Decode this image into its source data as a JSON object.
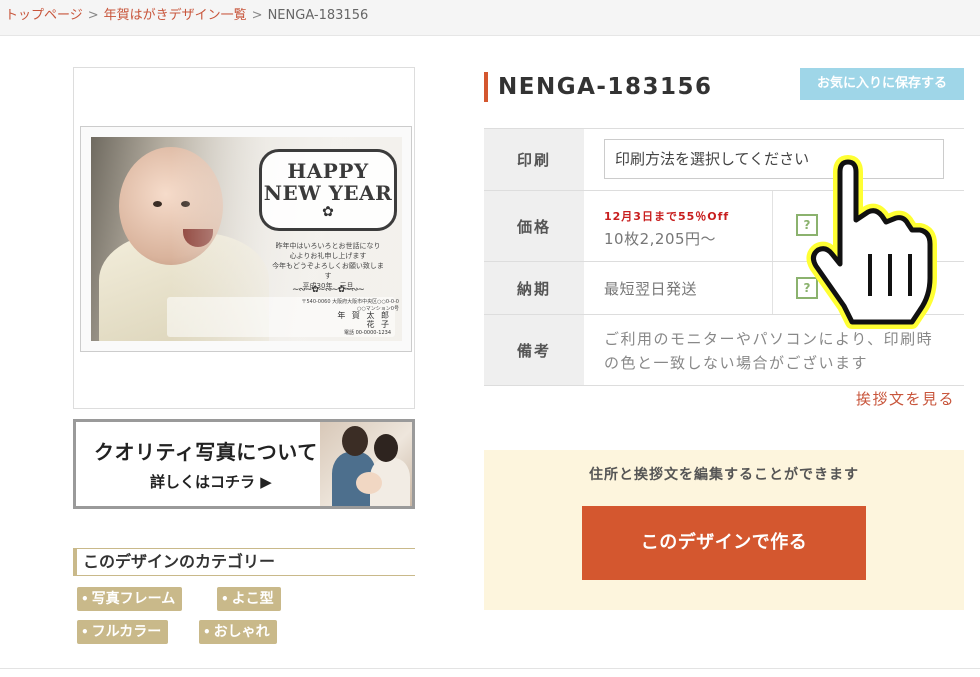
{
  "breadcrumb": {
    "items": [
      "トップページ",
      "年賀はがきデザイン一覧"
    ],
    "separator": ">",
    "current": "NENGA-183156"
  },
  "preview": {
    "card": {
      "greeting_heading_line1": "HAPPY",
      "greeting_heading_line2": "NEW YEAR",
      "greeting_lines": [
        "昨年中はいろいろとお世話になり",
        "心よりお礼申し上げます",
        "今年もどうぞよろしくお願い致します",
        "平成30年　元旦"
      ],
      "address_lines": [
        "〒540-0060 大阪府大阪市中央区○○0-0-0",
        "○○マンション0号"
      ],
      "sender_name_lines": [
        "年 賀 太 郎",
        "花 子"
      ],
      "phone": "電話 00-0000-1234"
    }
  },
  "quality_banner": {
    "title": "クオリティ写真について",
    "subtitle": "詳しくはコチラ ▶"
  },
  "categories": {
    "heading": "このデザインのカテゴリー",
    "tags": [
      "写真フレーム",
      "よこ型",
      "フルカラー",
      "おしゃれ"
    ]
  },
  "product": {
    "title": "NENGA-183156",
    "favorite_button": "お気に入りに保存する"
  },
  "spec": {
    "print_label": "印刷",
    "print_select_value": "印刷方法を選択してください",
    "price_label": "価格",
    "sale_text": "12月3日まで55％Off",
    "price_text": "10枚2,205円～",
    "delivery_label": "納期",
    "delivery_text": "最短翌日発送",
    "note_label": "備考",
    "note_text": "ご利用のモニターやパソコンにより、印刷時の色と一致しない場合がございます",
    "help_mark": "?"
  },
  "greeting_link": "挨拶文を見る",
  "edit_section": {
    "caption": "住所と挨拶文を編集することができます",
    "create_button": "このデザインで作る"
  },
  "colors": {
    "accent": "#d4572f",
    "link": "#c8553b",
    "favorite_bg": "#9fd6e8",
    "tag_bg": "#c9b98a",
    "sale_red": "#c81e1e",
    "edit_bg": "#fdf5dd"
  }
}
